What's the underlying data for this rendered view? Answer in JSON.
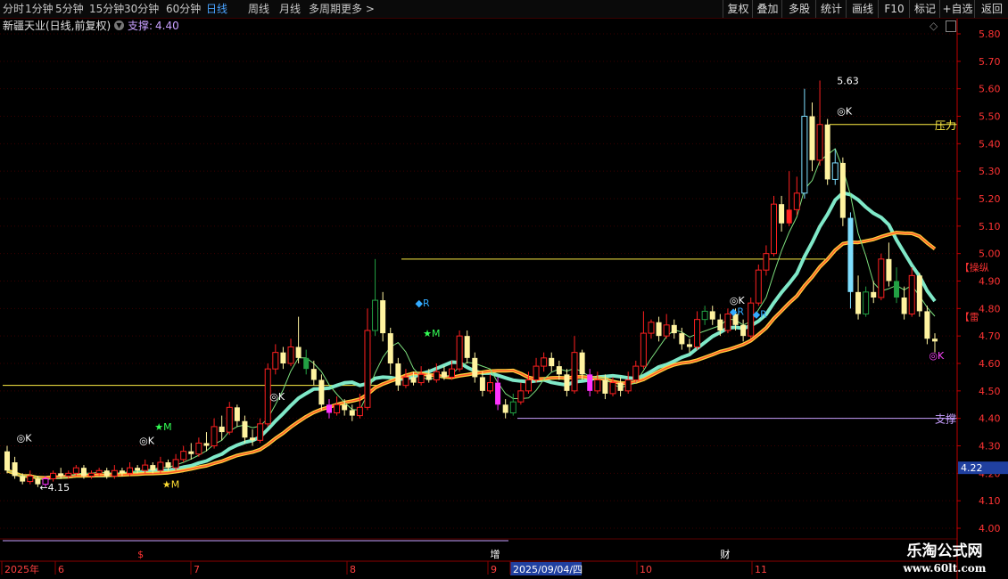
{
  "toolbar": {
    "periods": [
      "分时",
      "1分钟",
      "5分钟",
      "15分钟",
      "30分钟",
      "60分钟",
      "日线",
      "周线",
      "月线",
      "多周期",
      "更多 >"
    ],
    "active_period": "日线",
    "actions": [
      "复权",
      "叠加",
      "多股",
      "统计",
      "画线",
      "F10",
      "标记",
      "+自选",
      "返回"
    ]
  },
  "title": {
    "stock": "新疆天业(日线,前复权)",
    "indicator_label": "支撑:",
    "indicator_value": "4.40"
  },
  "colors": {
    "up": "#ff2020",
    "down_yellow": "#fff3a0",
    "down_cyan": "#7fdfff",
    "down_green": "#22a043",
    "down_magenta": "#ff33ff",
    "ma_fast": "#ff5a2c",
    "ma_band": "#ffd23c",
    "ma_slow": "#7fe8c8",
    "axis": "#c00000"
  },
  "chart_data": {
    "type": "candlestick",
    "ylim": [
      3.95,
      5.85
    ],
    "y_ticks": [
      "5.80",
      "5.70",
      "5.60",
      "5.50",
      "5.40",
      "5.30",
      "5.20",
      "5.10",
      "5.00",
      "4.90",
      "4.80",
      "4.70",
      "4.60",
      "4.50",
      "4.40",
      "4.30",
      "4.20",
      "4.10",
      "4.00"
    ],
    "current_price": "4.22",
    "x_labels": [
      "2025年",
      "6",
      "7",
      "8",
      "9",
      "2025/09/04/四",
      "10",
      "11"
    ],
    "candles": [
      [
        4.28,
        4.21,
        4.3,
        4.2
      ],
      [
        4.24,
        4.19,
        4.26,
        4.18
      ],
      [
        4.19,
        4.17,
        4.2,
        4.16
      ],
      [
        4.17,
        4.19,
        4.21,
        4.16
      ],
      [
        4.18,
        4.16,
        4.19,
        4.15
      ],
      [
        4.16,
        4.18,
        4.19,
        4.15
      ],
      [
        4.18,
        4.2,
        4.21,
        4.17
      ],
      [
        4.2,
        4.19,
        4.22,
        4.18
      ],
      [
        4.19,
        4.2,
        4.21,
        4.18
      ],
      [
        4.2,
        4.22,
        4.23,
        4.19
      ],
      [
        4.22,
        4.19,
        4.23,
        4.18
      ],
      [
        4.19,
        4.2,
        4.21,
        4.18
      ],
      [
        4.2,
        4.21,
        4.22,
        4.19
      ],
      [
        4.21,
        4.19,
        4.22,
        4.18
      ],
      [
        4.19,
        4.21,
        4.23,
        4.18
      ],
      [
        4.21,
        4.2,
        4.22,
        4.19
      ],
      [
        4.2,
        4.22,
        4.24,
        4.19
      ],
      [
        4.22,
        4.21,
        4.23,
        4.2
      ],
      [
        4.21,
        4.23,
        4.25,
        4.2
      ],
      [
        4.23,
        4.21,
        4.24,
        4.2
      ],
      [
        4.21,
        4.24,
        4.26,
        4.2
      ],
      [
        4.24,
        4.22,
        4.25,
        4.21
      ],
      [
        4.22,
        4.25,
        4.27,
        4.21
      ],
      [
        4.25,
        4.28,
        4.3,
        4.24
      ],
      [
        4.28,
        4.27,
        4.31,
        4.25
      ],
      [
        4.27,
        4.31,
        4.33,
        4.26
      ],
      [
        4.31,
        4.3,
        4.35,
        4.28
      ],
      [
        4.3,
        4.37,
        4.4,
        4.29
      ],
      [
        4.37,
        4.35,
        4.41,
        4.32
      ],
      [
        4.35,
        4.44,
        4.46,
        4.34
      ],
      [
        4.44,
        4.39,
        4.45,
        4.37
      ],
      [
        4.39,
        4.33,
        4.41,
        4.31
      ],
      [
        4.33,
        4.32,
        4.36,
        4.3
      ],
      [
        4.32,
        4.38,
        4.4,
        4.31
      ],
      [
        4.38,
        4.58,
        4.6,
        4.37
      ],
      [
        4.58,
        4.64,
        4.67,
        4.56
      ],
      [
        4.64,
        4.6,
        4.66,
        4.58
      ],
      [
        4.6,
        4.66,
        4.69,
        4.59
      ],
      [
        4.66,
        4.62,
        4.77,
        4.6
      ],
      [
        4.62,
        4.58,
        4.65,
        4.56
      ],
      [
        4.58,
        4.54,
        4.61,
        4.52
      ],
      [
        4.54,
        4.45,
        4.56,
        4.43
      ],
      [
        4.45,
        4.42,
        4.47,
        4.4
      ],
      [
        4.42,
        4.45,
        4.48,
        4.41
      ],
      [
        4.45,
        4.43,
        4.47,
        4.41
      ],
      [
        4.43,
        4.41,
        4.45,
        4.39
      ],
      [
        4.41,
        4.44,
        4.49,
        4.4
      ],
      [
        4.44,
        4.72,
        4.8,
        4.43
      ],
      [
        4.72,
        4.83,
        4.98,
        4.7
      ],
      [
        4.83,
        4.71,
        4.86,
        4.68
      ],
      [
        4.71,
        4.6,
        4.73,
        4.56
      ],
      [
        4.6,
        4.52,
        4.62,
        4.5
      ],
      [
        4.52,
        4.55,
        4.58,
        4.51
      ],
      [
        4.55,
        4.53,
        4.57,
        4.52
      ],
      [
        4.53,
        4.56,
        4.59,
        4.52
      ],
      [
        4.56,
        4.54,
        4.58,
        4.53
      ],
      [
        4.54,
        4.57,
        4.6,
        4.53
      ],
      [
        4.57,
        4.55,
        4.59,
        4.54
      ],
      [
        4.55,
        4.58,
        4.61,
        4.54
      ],
      [
        4.58,
        4.7,
        4.72,
        4.57
      ],
      [
        4.7,
        4.62,
        4.72,
        4.6
      ],
      [
        4.62,
        4.55,
        4.64,
        4.53
      ],
      [
        4.55,
        4.5,
        4.57,
        4.48
      ],
      [
        4.5,
        4.53,
        4.56,
        4.49
      ],
      [
        4.53,
        4.45,
        4.55,
        4.43
      ],
      [
        4.45,
        4.42,
        4.47,
        4.4
      ],
      [
        4.42,
        4.46,
        4.49,
        4.41
      ],
      [
        4.46,
        4.5,
        4.53,
        4.45
      ],
      [
        4.5,
        4.54,
        4.57,
        4.49
      ],
      [
        4.54,
        4.59,
        4.62,
        4.53
      ],
      [
        4.59,
        4.62,
        4.64,
        4.57
      ],
      [
        4.62,
        4.59,
        4.64,
        4.57
      ],
      [
        4.59,
        4.56,
        4.61,
        4.54
      ],
      [
        4.56,
        4.5,
        4.58,
        4.48
      ],
      [
        4.5,
        4.64,
        4.7,
        4.49
      ],
      [
        4.64,
        4.56,
        4.65,
        4.54
      ],
      [
        4.56,
        4.5,
        4.58,
        4.48
      ],
      [
        4.5,
        4.54,
        4.57,
        4.49
      ],
      [
        4.54,
        4.49,
        4.56,
        4.47
      ],
      [
        4.49,
        4.53,
        4.55,
        4.48
      ],
      [
        4.53,
        4.5,
        4.55,
        4.48
      ],
      [
        4.5,
        4.54,
        4.57,
        4.49
      ],
      [
        4.54,
        4.59,
        4.61,
        4.53
      ],
      [
        4.59,
        4.71,
        4.79,
        4.58
      ],
      [
        4.71,
        4.75,
        4.76,
        4.69
      ],
      [
        4.75,
        4.7,
        4.77,
        4.68
      ],
      [
        4.7,
        4.74,
        4.78,
        4.69
      ],
      [
        4.74,
        4.71,
        4.76,
        4.69
      ],
      [
        4.71,
        4.67,
        4.73,
        4.65
      ],
      [
        4.67,
        4.66,
        4.69,
        4.64
      ],
      [
        4.66,
        4.76,
        4.79,
        4.65
      ],
      [
        4.76,
        4.79,
        4.81,
        4.74
      ],
      [
        4.79,
        4.76,
        4.81,
        4.74
      ],
      [
        4.76,
        4.72,
        4.78,
        4.7
      ],
      [
        4.72,
        4.78,
        4.8,
        4.71
      ],
      [
        4.78,
        4.74,
        4.8,
        4.72
      ],
      [
        4.74,
        4.7,
        4.76,
        4.68
      ],
      [
        4.7,
        4.82,
        4.84,
        4.69
      ],
      [
        4.82,
        4.94,
        4.96,
        4.81
      ],
      [
        4.94,
        5.0,
        5.03,
        4.92
      ],
      [
        5.0,
        5.18,
        5.21,
        4.99
      ],
      [
        5.18,
        5.11,
        5.21,
        5.08
      ],
      [
        5.11,
        5.16,
        5.3,
        5.1
      ],
      [
        5.16,
        5.22,
        5.28,
        5.14
      ],
      [
        5.22,
        5.5,
        5.6,
        5.2
      ],
      [
        5.5,
        5.34,
        5.55,
        5.3
      ],
      [
        5.34,
        5.47,
        5.63,
        5.32
      ],
      [
        5.47,
        5.27,
        5.49,
        5.25
      ],
      [
        5.27,
        5.33,
        5.38,
        5.25
      ],
      [
        5.33,
        5.13,
        5.35,
        5.1
      ],
      [
        5.13,
        4.86,
        5.15,
        4.8
      ],
      [
        4.86,
        4.78,
        4.92,
        4.76
      ],
      [
        4.78,
        4.86,
        4.88,
        4.77
      ],
      [
        4.86,
        4.84,
        4.9,
        4.82
      ],
      [
        4.84,
        4.98,
        5.0,
        4.83
      ],
      [
        4.98,
        4.9,
        5.04,
        4.88
      ],
      [
        4.9,
        4.84,
        4.95,
        4.82
      ],
      [
        4.84,
        4.78,
        4.88,
        4.76
      ],
      [
        4.78,
        4.92,
        4.95,
        4.77
      ],
      [
        4.92,
        4.79,
        4.93,
        4.77
      ],
      [
        4.79,
        4.69,
        4.81,
        4.67
      ],
      [
        4.69,
        4.68,
        4.71,
        4.64
      ]
    ],
    "body_colors": {
      "cyan": [
        108,
        110,
        104
      ],
      "green": [
        48,
        66,
        91,
        112,
        116,
        39
      ],
      "magenta": [
        42,
        64,
        76,
        5
      ],
      "red_filled": [
        107,
        109,
        101,
        105,
        102
      ]
    },
    "lines": {
      "pressure": {
        "value": 5.47,
        "label": "压力",
        "color": "#ffee44"
      },
      "support": {
        "value": 4.4,
        "label": "支撑",
        "color": "#c8a0ff"
      },
      "line_a": {
        "value": 4.98,
        "color": "#ffee44"
      },
      "line_b": {
        "value": 4.52,
        "color": "#ffee44"
      }
    },
    "annotations": [
      {
        "text": "5.63",
        "x": 108,
        "y": 5.63,
        "color": "#ffffff"
      },
      {
        "text": "←4.15",
        "x": 4,
        "y": 4.15,
        "color": "#ffffff"
      },
      {
        "text": "◎K",
        "x": 1,
        "y": 4.33,
        "color": "#ffffff"
      },
      {
        "text": "◎K",
        "x": 17,
        "y": 4.32,
        "color": "#ffffff"
      },
      {
        "text": "◎K",
        "x": 34,
        "y": 4.48,
        "color": "#ffffff"
      },
      {
        "text": "◎K",
        "x": 94,
        "y": 4.83,
        "color": "#ffffff"
      },
      {
        "text": "◎K",
        "x": 108,
        "y": 5.52,
        "color": "#ffffff"
      },
      {
        "text": "◎K",
        "x": 120,
        "y": 4.63,
        "color": "#ff44ff"
      },
      {
        "text": "★M",
        "x": 19,
        "y": 4.37,
        "color": "#33ff55"
      },
      {
        "text": "★M",
        "x": 20,
        "y": 4.16,
        "color": "#ffdd33"
      },
      {
        "text": "★M",
        "x": 54,
        "y": 4.71,
        "color": "#33ff55"
      },
      {
        "text": "◆R",
        "x": 53,
        "y": 4.82,
        "color": "#33aaff"
      },
      {
        "text": "◆R",
        "x": 94,
        "y": 4.79,
        "color": "#33aaff"
      },
      {
        "text": "◆R",
        "x": 97,
        "y": 4.78,
        "color": "#33aaff"
      },
      {
        "text": "【操纵",
        "x": 124,
        "y": 4.95,
        "color": "#ff3333"
      },
      {
        "text": "【雷",
        "x": 124,
        "y": 4.77,
        "color": "#ff3333"
      }
    ],
    "bottom_markers": [
      {
        "text": "$",
        "x": 17,
        "color": "#ff3333"
      },
      {
        "text": "增",
        "x": 63,
        "color": "#ffffff"
      },
      {
        "text": "财",
        "x": 93,
        "color": "#ffffff"
      }
    ]
  },
  "watermark": {
    "line1": "乐淘公式网",
    "line2": "www.60lt.com"
  }
}
